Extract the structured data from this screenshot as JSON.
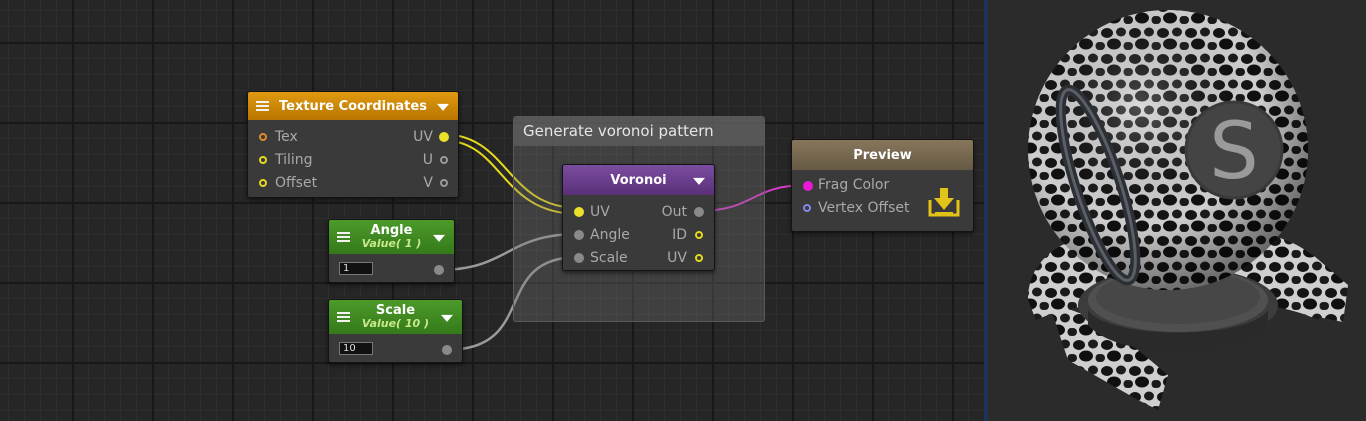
{
  "nodes": {
    "texture_coordinates": {
      "title": "Texture Coordinates",
      "inputs": [
        "Tex",
        "Tiling",
        "Offset"
      ],
      "outputs": [
        "UV",
        "U",
        "V"
      ]
    },
    "angle": {
      "title": "Angle",
      "subtitle": "Value( 1 )",
      "value": "1"
    },
    "scale": {
      "title": "Scale",
      "subtitle": "Value( 10 )",
      "value": "10"
    },
    "voronoi": {
      "title": "Voronoi",
      "inputs": [
        "UV",
        "Angle",
        "Scale"
      ],
      "outputs": [
        "Out",
        "ID",
        "UV"
      ]
    },
    "preview": {
      "title": "Preview",
      "inputs": [
        "Frag Color",
        "Vertex Offset"
      ]
    }
  },
  "group": {
    "title": "Generate voronoi pattern"
  },
  "preview_panel": {
    "logo_letter": "S"
  },
  "colors": {
    "texcoord_header": "#d28d06",
    "value_header": "#3f8a22",
    "voronoi_header": "#6b3f8f",
    "preview_header": "#7a6a52",
    "wire_uv": "#e6d81c",
    "wire_value": "#9a9a9a",
    "wire_color": "#d63ac9",
    "divider": "#1e3357"
  }
}
